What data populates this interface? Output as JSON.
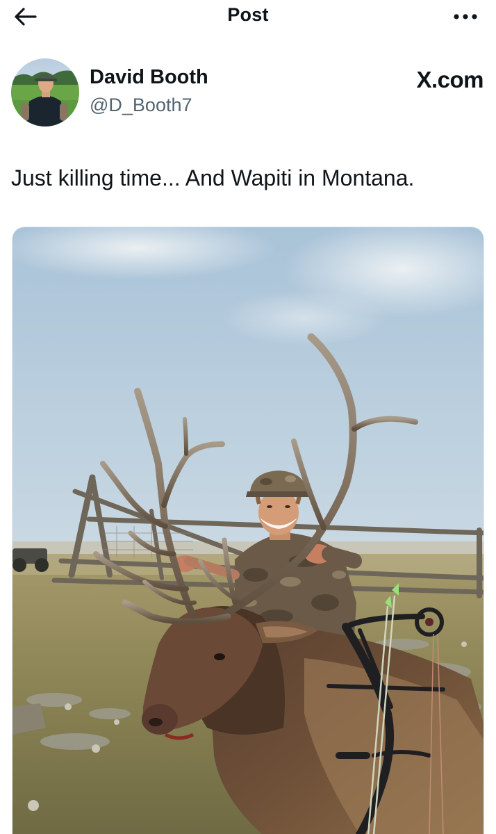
{
  "header": {
    "title": "Post",
    "back_icon": "arrow-left-icon",
    "more_icon": "more-horizontal-icon"
  },
  "author": {
    "name": "David Booth",
    "handle": "@D_Booth7",
    "brand": "X.com"
  },
  "post": {
    "text": "Just killing time... And Wapiti in Montana."
  },
  "colors": {
    "text_primary": "#0f1419",
    "text_secondary": "#536471"
  }
}
